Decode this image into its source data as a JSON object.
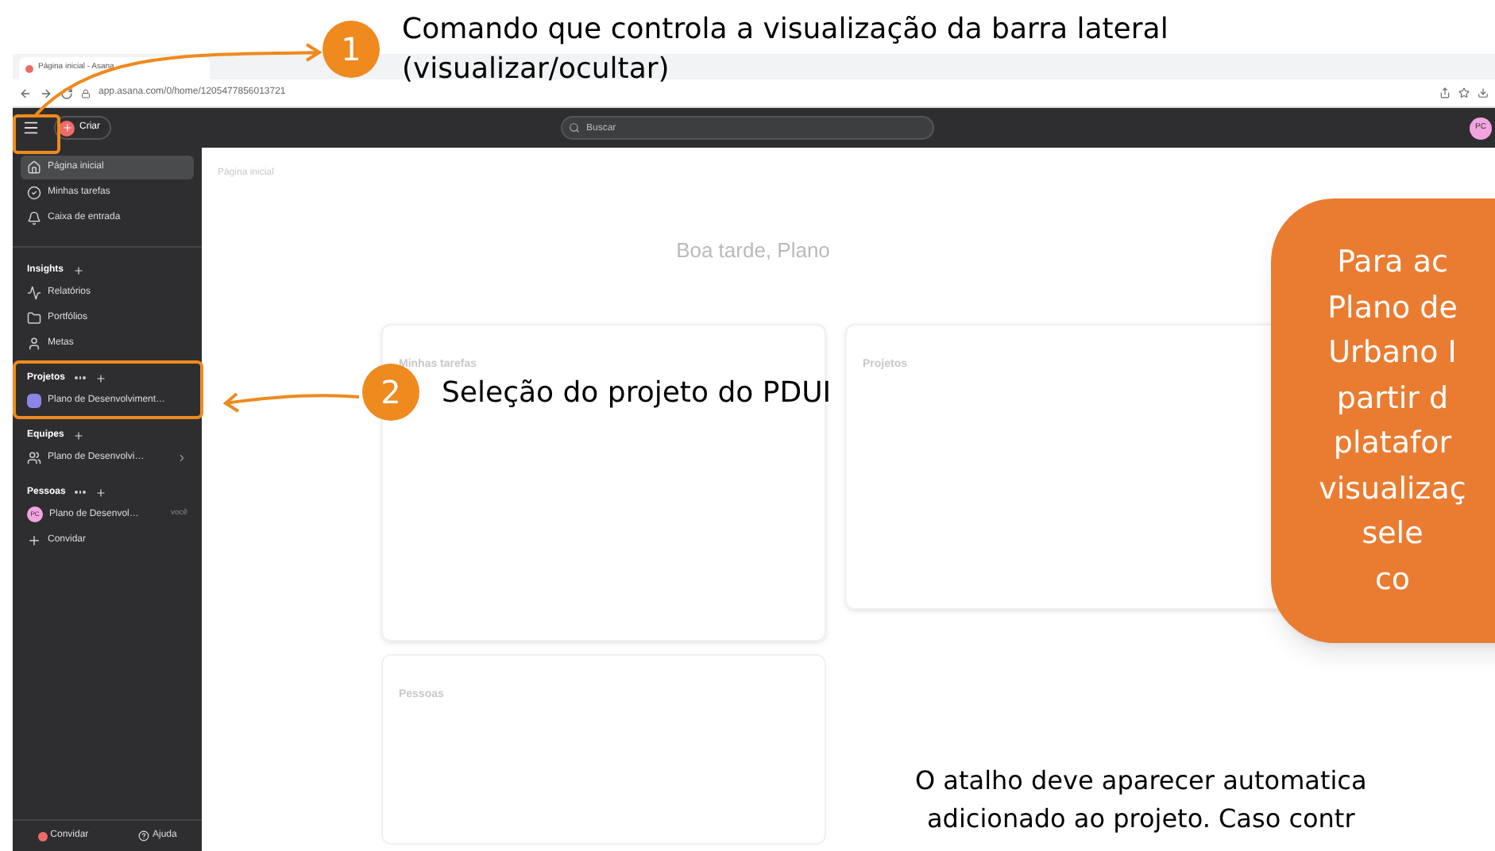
{
  "browser": {
    "tab_title": "Página inicial - Asana",
    "url": "app.asana.com/0/home/1205477856013721"
  },
  "topbar": {
    "create_label": "Criar",
    "search_placeholder": "Buscar",
    "avatar": "PC"
  },
  "sidebar": {
    "nav": [
      {
        "label": "Página inicial",
        "selected": true
      },
      {
        "label": "Minhas tarefas",
        "selected": false
      },
      {
        "label": "Caixa de entrada",
        "selected": false
      }
    ],
    "sections": [
      {
        "title": "Insights",
        "more": false,
        "items": [
          {
            "label": "Relatórios",
            "chevron": false
          },
          {
            "label": "Portfólios",
            "chevron": false
          },
          {
            "label": "Metas",
            "chevron": false
          }
        ]
      },
      {
        "title": "Projetos",
        "more": true,
        "items": [
          {
            "label": "Plano de Desenvolviment…",
            "chevron": false
          }
        ]
      },
      {
        "title": "Equipes",
        "more": false,
        "items": [
          {
            "label": "Plano de Desenvolvi…",
            "chevron": true
          }
        ]
      },
      {
        "title": "Pessoas",
        "more": true,
        "items": [
          {
            "label": "Plano de Desenvol…",
            "avatar": "PC",
            "tag": "você",
            "chevron": false
          },
          {
            "label": "Convidar",
            "chevron": false
          }
        ]
      }
    ],
    "footer": {
      "invite": "Convidar",
      "help": "Ajuda"
    }
  },
  "main": {
    "title": "Página inicial",
    "greeting": "Boa tarde, Plano",
    "cards": [
      {
        "title": "Minhas tarefas"
      },
      {
        "title": "Projetos"
      }
    ],
    "people_title": "Pessoas"
  },
  "annotations": [
    {
      "number": "1",
      "lines": [
        "Comando que controla a visualização da barra lateral",
        "(visualizar/ocultar)"
      ]
    },
    {
      "number": "2",
      "lines": [
        "Seleção do projeto do PDUI"
      ]
    }
  ],
  "callout": {
    "lines": [
      "Para ac",
      "Plano de",
      "Urbano I",
      "partir d",
      "platafor",
      "visualizaç",
      "sele",
      "co"
    ]
  },
  "note": {
    "lines": [
      "O atalho deve aparecer automatica",
      "adicionado ao projeto. Caso contr"
    ]
  }
}
